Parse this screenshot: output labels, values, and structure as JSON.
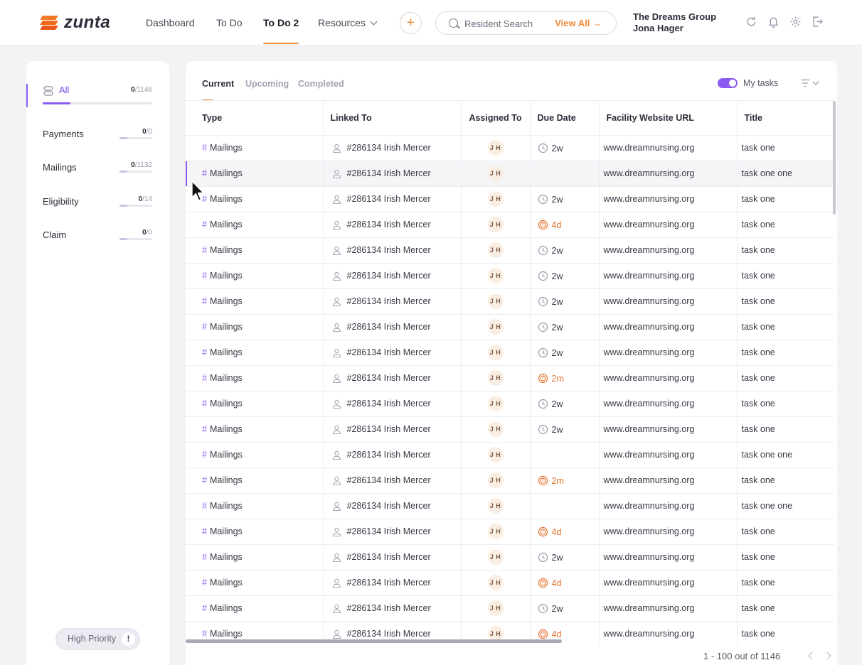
{
  "brand": {
    "name": "zunta",
    "logo_color": "#f26a1b"
  },
  "nav": {
    "items": [
      {
        "label": "Dashboard",
        "active": false
      },
      {
        "label": "To Do",
        "active": false
      },
      {
        "label": "To Do 2",
        "active": true
      },
      {
        "label": "Resources",
        "active": false,
        "has_dropdown": true
      }
    ],
    "add_icon": "plus-icon"
  },
  "search": {
    "placeholder": "Resident Search",
    "view_all": "View All →",
    "icon": "search-icon"
  },
  "account": {
    "org": "The Dreams Group",
    "user": "Jona Hager"
  },
  "top_icons": [
    "refresh-icon",
    "bell-icon",
    "gear-icon",
    "logout-icon"
  ],
  "sidebar": {
    "categories": [
      {
        "label": "All",
        "done": "0",
        "total": "/1146",
        "active": true,
        "icon": "stack-icon"
      },
      {
        "label": "Payments",
        "done": "0",
        "total": "/0",
        "active": false
      },
      {
        "label": "Mailings",
        "done": "0",
        "total": "/1132",
        "active": false
      },
      {
        "label": "Eligibility",
        "done": "0",
        "total": "/14",
        "active": false
      },
      {
        "label": "Claim",
        "done": "0",
        "total": "/0",
        "active": false
      }
    ],
    "high_priority": {
      "label": "High Priority",
      "badge": "!"
    }
  },
  "tabs": [
    {
      "label": "Current",
      "active": true
    },
    {
      "label": "Upcoming",
      "active": false
    },
    {
      "label": "Completed",
      "active": false
    }
  ],
  "my_tasks": {
    "label": "My tasks",
    "enabled": true
  },
  "filter_icon": "filter-icon",
  "table": {
    "columns": [
      "Type",
      "Linked To",
      "Assigned To",
      "Due Date",
      "Facility Website URL",
      "Title"
    ],
    "rows": [
      {
        "type": "Mailings",
        "linked": "#286134 Irish Mercer",
        "assignee": "J H",
        "due": "2w",
        "late": false,
        "url": "www.dreamnursing.org",
        "title": "task one"
      },
      {
        "type": "Mailings",
        "linked": "#286134 Irish Mercer",
        "assignee": "J H",
        "due": "",
        "late": false,
        "url": "www.dreamnursing.org",
        "title": "task one one",
        "highlighted": true
      },
      {
        "type": "Mailings",
        "linked": "#286134 Irish Mercer",
        "assignee": "J H",
        "due": "2w",
        "late": false,
        "url": "www.dreamnursing.org",
        "title": "task one"
      },
      {
        "type": "Mailings",
        "linked": "#286134 Irish Mercer",
        "assignee": "J H",
        "due": "4d",
        "late": true,
        "url": "www.dreamnursing.org",
        "title": "task one"
      },
      {
        "type": "Mailings",
        "linked": "#286134 Irish Mercer",
        "assignee": "J H",
        "due": "2w",
        "late": false,
        "url": "www.dreamnursing.org",
        "title": "task one"
      },
      {
        "type": "Mailings",
        "linked": "#286134 Irish Mercer",
        "assignee": "J H",
        "due": "2w",
        "late": false,
        "url": "www.dreamnursing.org",
        "title": "task one"
      },
      {
        "type": "Mailings",
        "linked": "#286134 Irish Mercer",
        "assignee": "J H",
        "due": "2w",
        "late": false,
        "url": "www.dreamnursing.org",
        "title": "task one"
      },
      {
        "type": "Mailings",
        "linked": "#286134 Irish Mercer",
        "assignee": "J H",
        "due": "2w",
        "late": false,
        "url": "www.dreamnursing.org",
        "title": "task one"
      },
      {
        "type": "Mailings",
        "linked": "#286134 Irish Mercer",
        "assignee": "J H",
        "due": "2w",
        "late": false,
        "url": "www.dreamnursing.org",
        "title": "task one"
      },
      {
        "type": "Mailings",
        "linked": "#286134 Irish Mercer",
        "assignee": "J H",
        "due": "2m",
        "late": true,
        "url": "www.dreamnursing.org",
        "title": "task one"
      },
      {
        "type": "Mailings",
        "linked": "#286134 Irish Mercer",
        "assignee": "J H",
        "due": "2w",
        "late": false,
        "url": "www.dreamnursing.org",
        "title": "task one"
      },
      {
        "type": "Mailings",
        "linked": "#286134 Irish Mercer",
        "assignee": "J H",
        "due": "2w",
        "late": false,
        "url": "www.dreamnursing.org",
        "title": "task one"
      },
      {
        "type": "Mailings",
        "linked": "#286134 Irish Mercer",
        "assignee": "J H",
        "due": "",
        "late": false,
        "url": "www.dreamnursing.org",
        "title": "task one one"
      },
      {
        "type": "Mailings",
        "linked": "#286134 Irish Mercer",
        "assignee": "J H",
        "due": "2m",
        "late": true,
        "url": "www.dreamnursing.org",
        "title": "task one"
      },
      {
        "type": "Mailings",
        "linked": "#286134 Irish Mercer",
        "assignee": "J H",
        "due": "",
        "late": false,
        "url": "www.dreamnursing.org",
        "title": "task one one"
      },
      {
        "type": "Mailings",
        "linked": "#286134 Irish Mercer",
        "assignee": "J H",
        "due": "4d",
        "late": true,
        "url": "www.dreamnursing.org",
        "title": "task one"
      },
      {
        "type": "Mailings",
        "linked": "#286134 Irish Mercer",
        "assignee": "J H",
        "due": "2w",
        "late": false,
        "url": "www.dreamnursing.org",
        "title": "task one"
      },
      {
        "type": "Mailings",
        "linked": "#286134 Irish Mercer",
        "assignee": "J H",
        "due": "4d",
        "late": true,
        "url": "www.dreamnursing.org",
        "title": "task one"
      },
      {
        "type": "Mailings",
        "linked": "#286134 Irish Mercer",
        "assignee": "J H",
        "due": "2w",
        "late": false,
        "url": "www.dreamnursing.org",
        "title": "task one"
      },
      {
        "type": "Mailings",
        "linked": "#286134 Irish Mercer",
        "assignee": "J H",
        "due": "4d",
        "late": true,
        "url": "www.dreamnursing.org",
        "title": "task one"
      }
    ]
  },
  "pagination": {
    "label": "1 - 100 out of 1146",
    "prev_icon": "chevron-left-icon",
    "next_icon": "chevron-right-icon"
  },
  "colors": {
    "accent": "#8a5cf0",
    "brand": "#f08b3b",
    "late": "#e4702a"
  }
}
